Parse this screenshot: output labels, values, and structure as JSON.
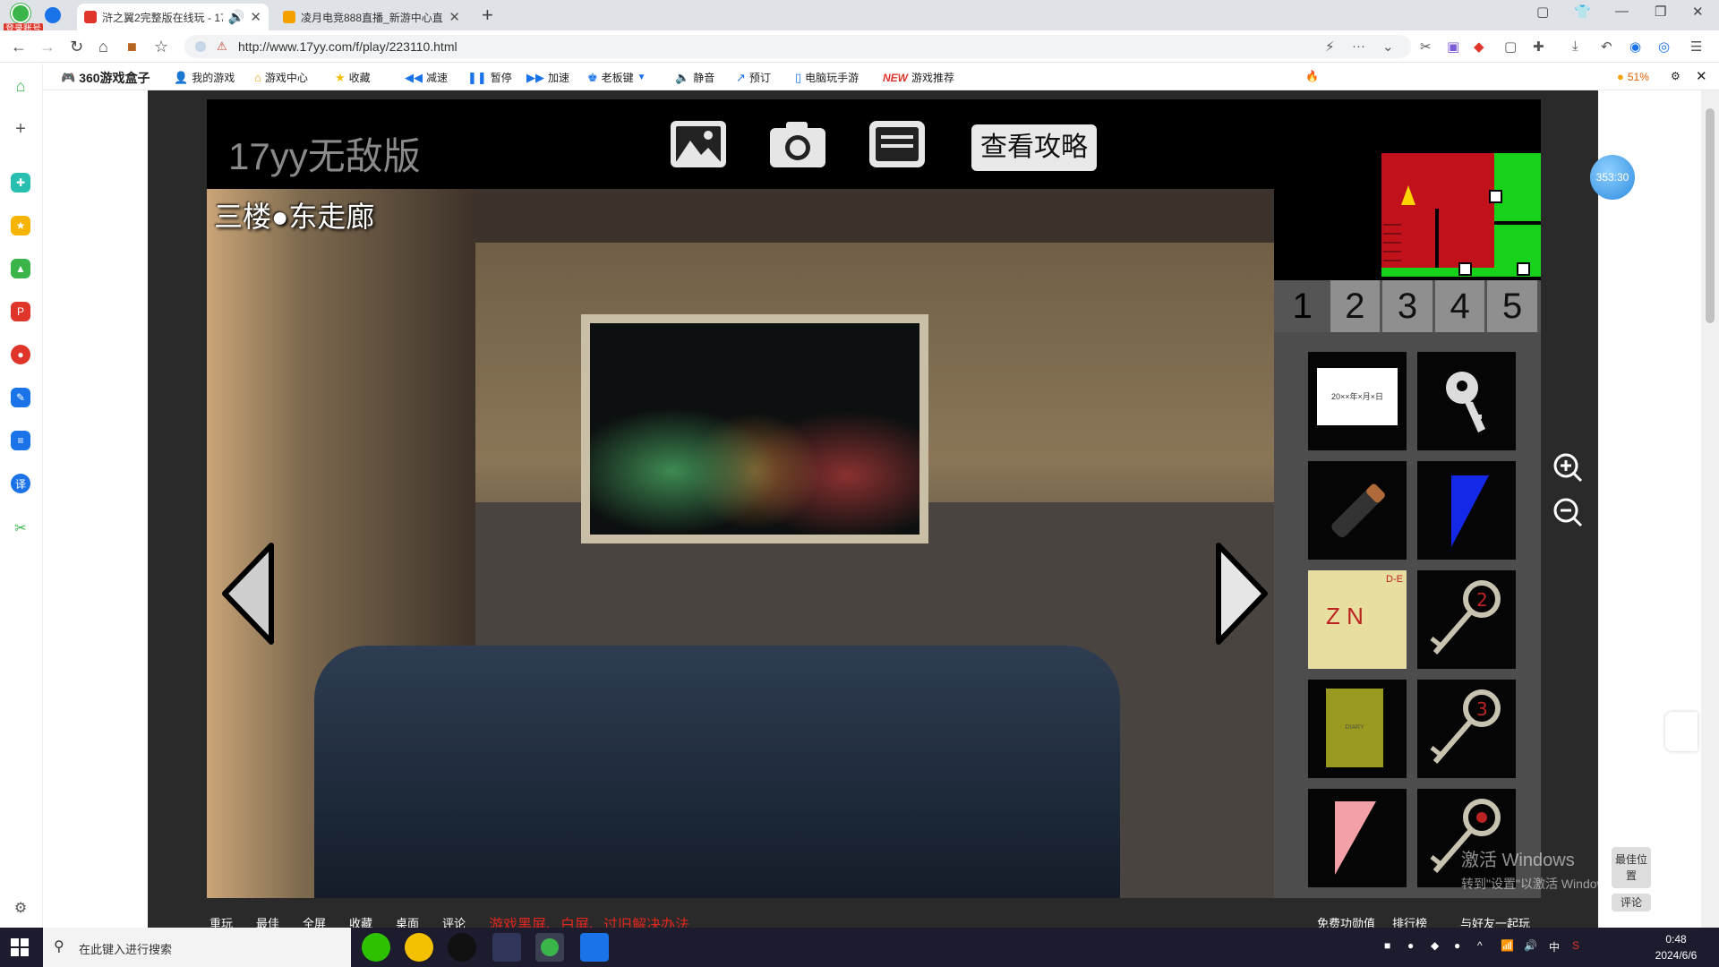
{
  "browser": {
    "account_label": "登录账号",
    "tabs": [
      {
        "title": "浒之翼2完整版在线玩 - 17",
        "active": true,
        "favicon_color": "#e0352b"
      },
      {
        "title": "凌月电竞888直播_新游中心直",
        "active": false,
        "favicon_color": "#f4a100"
      }
    ],
    "url": "http://www.17yy.com/f/play/223110.html"
  },
  "toolbar": {
    "brand": "360游戏盒子",
    "items": [
      "我的游戏",
      "游戏中心",
      "收藏",
      "减速",
      "暂停",
      "加速",
      "老板键",
      "静音",
      "预订",
      "电脑玩手游"
    ],
    "recommend_new": "NEW",
    "recommend_label": "游戏推荐",
    "battery": "51%"
  },
  "game": {
    "logo": "17yy无敌版",
    "guide_button": "查看攻略",
    "location": "三楼●东走廊",
    "floors": [
      "1",
      "2",
      "3",
      "4",
      "5"
    ],
    "current_floor": "3",
    "inventory": [
      {
        "icon": "date-note-icon",
        "label": "20××年×月×日"
      },
      {
        "icon": "key-icon"
      },
      {
        "icon": "battery-icon"
      },
      {
        "icon": "blue-triangle-icon"
      },
      {
        "icon": "paper-note-icon",
        "text": "D-E",
        "sub": "Z N"
      },
      {
        "icon": "ornate-key-2-icon"
      },
      {
        "icon": "diary-book-icon",
        "text": "DIARY"
      },
      {
        "icon": "ornate-key-3-icon"
      },
      {
        "icon": "pink-triangle-icon"
      },
      {
        "icon": "ornate-key-om-icon"
      }
    ]
  },
  "overlay": {
    "timer": "353:30",
    "best_position": "最佳位置",
    "comment": "评论",
    "windows_activate_title": "激活 Windows",
    "windows_activate_sub": "转到\"设置\"以激活 Windows。"
  },
  "bottom_links": {
    "left": [
      "重玩",
      "最佳",
      "全屏",
      "收藏",
      "桌面",
      "评论"
    ],
    "notice": "游戏黑屏、白屏、过旧解决办法",
    "right": [
      "免费功勋值",
      "排行榜",
      "与好友一起玩"
    ]
  },
  "taskbar": {
    "search_placeholder": "在此键入进行搜索",
    "ime": "中",
    "time": "0:48",
    "date": "2024/6/6"
  }
}
